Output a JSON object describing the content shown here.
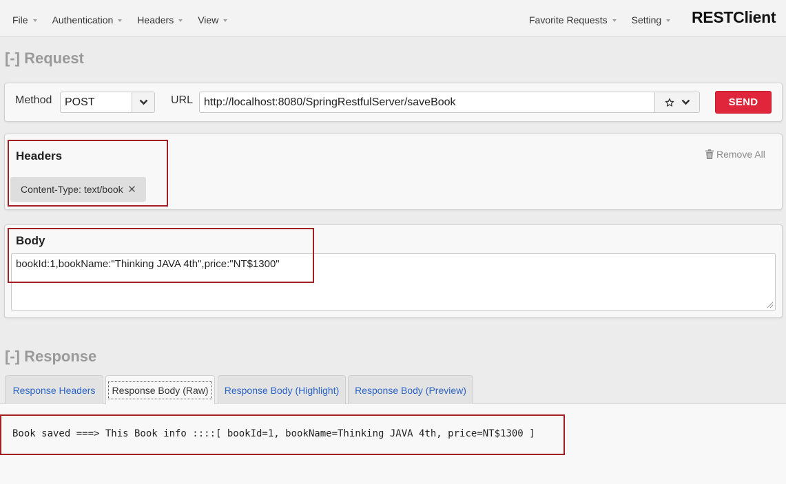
{
  "menu": {
    "left": [
      "File",
      "Authentication",
      "Headers",
      "View"
    ],
    "right": [
      "Favorite Requests",
      "Setting"
    ],
    "brand": "RESTClient"
  },
  "request": {
    "section_title": "[-] Request",
    "method_label": "Method",
    "method_value": "POST",
    "url_label": "URL",
    "url_value": "http://localhost:8080/SpringRestfulServer/saveBook",
    "send_label": "SEND"
  },
  "headers": {
    "title": "Headers",
    "remove_all": "Remove All",
    "items": [
      "Content-Type: text/book"
    ]
  },
  "body": {
    "title": "Body",
    "content": "bookId:1,bookName:\"Thinking JAVA 4th\",price:\"NT$1300\""
  },
  "response": {
    "section_title": "[-] Response",
    "tabs": [
      "Response Headers",
      "Response Body (Raw)",
      "Response Body (Highlight)",
      "Response Body (Preview)"
    ],
    "active_tab": "Response Body (Raw)",
    "body_raw": "Book saved ===> This Book info ::::[ bookId=1, bookName=Thinking JAVA 4th, price=NT$1300 ]"
  },
  "colors": {
    "send_button": "#e0263a",
    "tab_link": "#2a65c6",
    "highlight_box": "#a31f22"
  }
}
